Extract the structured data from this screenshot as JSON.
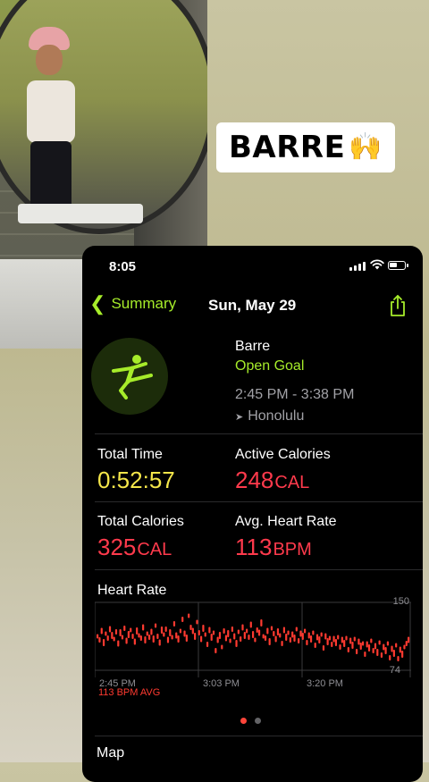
{
  "story": {
    "tag_text": "BARRE",
    "tag_emoji": "🙌"
  },
  "status_bar": {
    "time": "8:05"
  },
  "nav": {
    "back_label": "Summary",
    "date": "Sun, May 29",
    "share_icon": "share-icon"
  },
  "workout": {
    "name": "Barre",
    "goal": "Open Goal",
    "time_range": "2:45 PM - 3:38 PM",
    "location": "Honolulu"
  },
  "stats": {
    "total_time_label": "Total Time",
    "total_time_value": "0:52:57",
    "active_cal_label": "Active Calories",
    "active_cal_value": "248",
    "active_cal_unit": "CAL",
    "total_cal_label": "Total Calories",
    "total_cal_value": "325",
    "total_cal_unit": "CAL",
    "avg_hr_label": "Avg. Heart Rate",
    "avg_hr_value": "113",
    "avg_hr_unit": "BPM"
  },
  "heart_rate": {
    "title": "Heart Rate",
    "avg_label": "113 BPM AVG",
    "y_max_label": "150",
    "y_min_label": "74",
    "x_labels": [
      "2:45 PM",
      "3:03 PM",
      "3:20 PM"
    ]
  },
  "chart_data": {
    "type": "scatter",
    "y_range": [
      74,
      150
    ],
    "x": [
      "2:45 PM",
      "3:03 PM",
      "3:20 PM"
    ],
    "series": [
      {
        "color": "#ff3a30",
        "values": [
          112,
          108,
          118,
          105,
          115,
          110,
          120,
          113,
          109,
          117,
          104,
          116,
          111,
          121,
          107,
          114,
          119,
          112,
          106,
          118,
          113,
          110,
          122,
          108,
          115,
          111,
          117,
          109,
          124,
          112,
          105,
          119,
          114,
          120,
          108,
          116,
          111,
          126,
          113,
          109,
          118,
          131,
          115,
          110,
          135,
          122,
          118,
          112,
          128,
          116,
          109,
          121,
          114,
          103,
          119,
          111,
          116,
          96,
          108,
          113,
          100,
          118,
          110,
          115,
          107,
          120,
          112,
          104,
          117,
          109,
          122,
          113,
          118,
          111,
          125,
          114,
          108,
          119,
          116,
          127,
          112,
          110,
          118,
          106,
          121,
          115,
          109,
          117,
          113,
          104,
          119,
          111,
          116,
          108,
          114,
          110,
          120,
          107,
          115,
          112,
          118,
          105,
          113,
          109,
          116,
          102,
          111,
          108,
          114,
          99,
          112,
          106,
          110,
          103,
          109,
          105,
          111,
          100,
          108,
          104,
          110,
          97,
          107,
          102,
          109,
          95,
          106,
          101,
          104,
          92,
          103,
          99,
          107,
          96,
          101,
          94,
          105,
          91,
          100,
          96,
          104,
          88,
          98,
          93,
          102,
          87,
          97,
          92,
          100,
          104,
          108
        ]
      }
    ]
  },
  "pager": {
    "active_color": "#ff453a",
    "inactive_color": "#636366"
  },
  "map": {
    "title": "Map"
  }
}
